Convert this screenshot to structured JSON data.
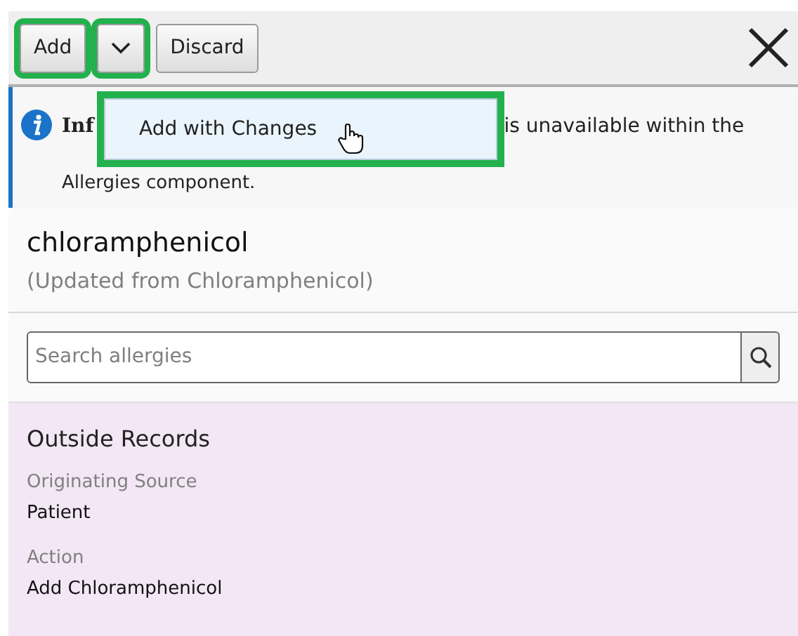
{
  "toolbar": {
    "buttons": [
      {
        "kind": "text",
        "label": "Add",
        "highlighted": true
      },
      {
        "kind": "caret",
        "highlighted": true
      },
      {
        "kind": "text",
        "label": "Discard",
        "highlighted": false
      }
    ]
  },
  "dropdown_menu": {
    "highlighted": true,
    "items": [
      {
        "label": "Add with Changes",
        "hovered": true
      }
    ]
  },
  "info_banner": {
    "title": "Inf",
    "line_1_tail": "is unavailable within the",
    "line_2": "Allergies component."
  },
  "allergen": {
    "name": "chloramphenicol",
    "note": "(Updated from Chloramphenicol)"
  },
  "search": {
    "placeholder": "Search allergies"
  },
  "outside_records": {
    "title": "Outside Records",
    "fields": [
      {
        "label": "Originating Source",
        "value": "Patient"
      },
      {
        "label": "Action",
        "value": "Add Chloramphenicol"
      }
    ]
  }
}
